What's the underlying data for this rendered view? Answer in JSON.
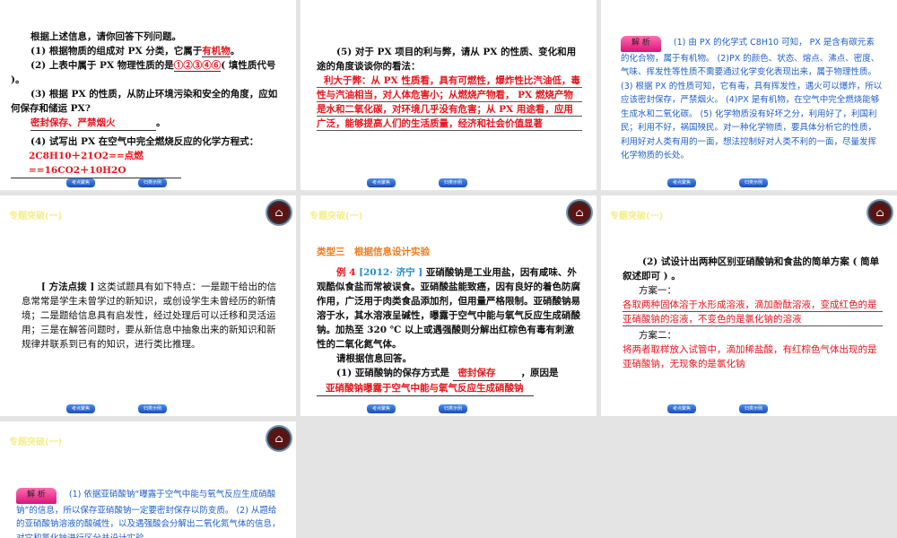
{
  "nav": {
    "prev": "考点聚焦",
    "next": "归类示例"
  },
  "header": "专题突破(一)",
  "s1": {
    "l1": "根据上述信息，请你回答下列问题。",
    "q1": "(1) 根据物质的组成对 PX 分类，它属于",
    "a1": "有机物",
    "q2": "(2) 上表中属于 PX 物理性质的是",
    "a2": "①②③④⑥",
    "q2b": "( 填性质代号 )。",
    "q3": "(3) 根据 PX 的性质，从防止环境污染和安全的角度，应如何保存和储运 PX?",
    "a3": "密封保存、严禁烟火",
    "q4": "(4) 试写出 PX 在空气中完全燃烧反应的化学方程式：",
    "a4": "2C8H10＋21O2==点燃==16CO2＋10H2O"
  },
  "s2": {
    "q5": "(5) 对于 PX 项目的利与弊，请从 PX 的性质、变化和用途的角度谈谈你的看法：",
    "a5": "利大于弊：从 PX 性质看，具有可燃性，爆炸性比汽油低，毒性与汽油相当，对人体危害小；从燃烧产物看， PX 燃烧产物是水和二氧化碳，对环境几乎没有危害；从 PX 用途看，应用广泛，能够提高人们的生活质量，经济和社会价值显著"
  },
  "s3": {
    "label": "解 析",
    "text": "(1) 由 PX 的化学式 C8H10 可知， PX 是含有碳元素的化合物，属于有机物。 (2)PX 的颜色、状态、熔点、沸点、密度、气味、挥发性等性质不需要通过化学变化表现出来，属于物理性质。 (3) 根据 PX 的性质可知，它有毒，具有挥发性，遇火可以爆炸，所以应该密封保存，严禁烟火。 (4)PX 是有机物，在空气中完全燃烧能够生成水和二氧化碳。 (5) 化学物质没有好坏之分，利用好了，利国利民；利用不好，祸国殃民。对一种化学物质，要具体分析它的性质，利用好对人类有用的一面，想法控制好对人类不利的一面，尽量发挥化学物质的长处。"
  },
  "s4": {
    "title": "[ 方法点拨 ]",
    "text": "这类试题具有如下特点：一是题干给出的信息常常是学生未曾学过的新知识，或创设学生未曾经历的新情境；二是题给信息具有启发性，经过处理后可以迁移和灵活运用；三是在解答问题时，要从新信息中抽象出来的新知识和新规律并联系到已有的知识，进行类比推理。"
  },
  "s5": {
    "type": "类型三　根据信息设计实验",
    "ex": "例 4",
    "src": "[2012· 济宁 ]",
    "text": "亚硝酸钠是工业用盐，因有咸味、外观酷似食盐而常被误食。亚硝酸盐能致癌，因有良好的着色防腐作用，广泛用于肉类食品添加剂，但用量严格限制。亚硝酸钠易溶于水，其水溶液呈碱性，曝露于空气中能与氧气反应生成硝酸钠。加热至 320 ℃ 以上或遇强酸则分解出红棕色有毒有刺激性的二氧化氮气体。",
    "ask": "请根据信息回答。",
    "q1": "(1) 亚硝酸钠的保存方式是",
    "a1": "密封保存",
    "q1b": "，原因是",
    "a1b": "亚硝酸钠曝露于空气中能与氧气反应生成硝酸钠"
  },
  "s6": {
    "q2": "(2) 试设计出两种区别亚硝酸钠和食盐的简单方案 ( 简单叙述即可 ) 。",
    "p1": "方案一：",
    "a1": "各取两种固体溶于水形成溶液，滴加酚酞溶液，变成红色的是亚硝酸钠的溶液，不变色的是氯化钠的溶液",
    "p2": "方案二：",
    "a2": "将两者取样放入试管中，滴加稀盐酸，有红棕色气体出现的是亚硝酸钠，无现象的是氯化钠"
  },
  "s7": {
    "label": "解 析",
    "text": "(1) 依据亚硝酸钠“曝露于空气中能与氧气反应生成硝酸钠”的信息，所以保存亚硝酸钠一定要密封保存以防变质。 (2) 从题给的亚硝酸钠溶液的酸碱性，以及遇强酸会分解出二氧化氮气体的信息，对它和氯化钠进行区分并设计实验。"
  }
}
